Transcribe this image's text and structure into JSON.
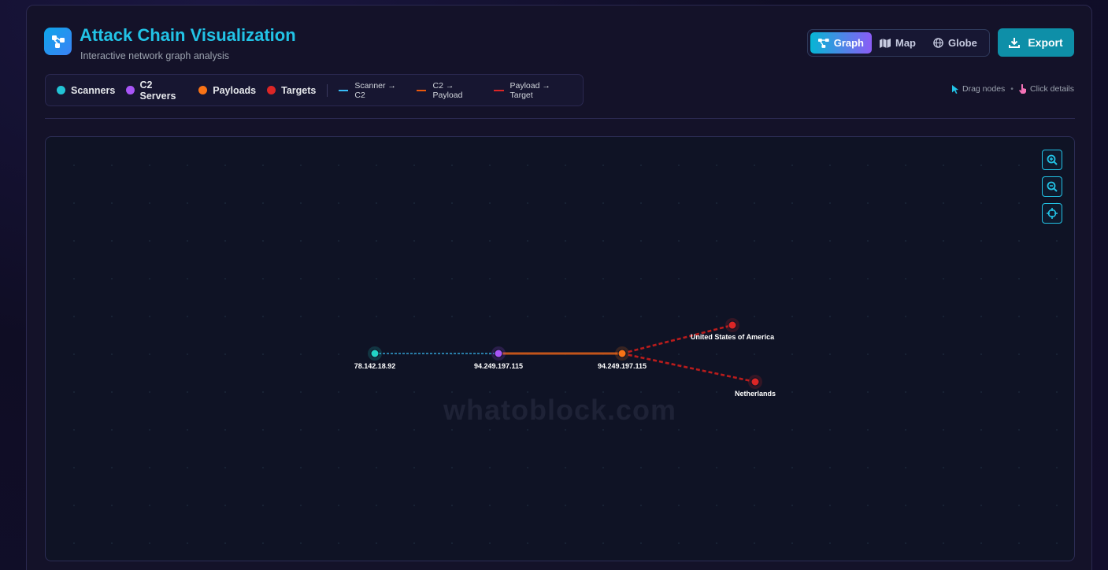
{
  "header": {
    "title": "Attack Chain Visualization",
    "subtitle": "Interactive network graph analysis"
  },
  "view_toggle": {
    "items": [
      {
        "label": "Graph",
        "active": true,
        "icon": "graph-icon"
      },
      {
        "label": "Map",
        "active": false,
        "icon": "map-icon"
      },
      {
        "label": "Globe",
        "active": false,
        "icon": "globe-icon"
      }
    ]
  },
  "export_label": "Export",
  "legend": {
    "nodes": [
      {
        "label": "Scanners",
        "color": "#22c3d6"
      },
      {
        "label": "C2 Servers",
        "color": "#a855f7"
      },
      {
        "label": "Payloads",
        "color": "#f97316"
      },
      {
        "label": "Targets",
        "color": "#dc2626"
      }
    ],
    "edges": [
      {
        "label": "Scanner → C2",
        "color": "#38bdf8",
        "style": "dashed"
      },
      {
        "label": "C2 → Payload",
        "color": "#ea580c",
        "style": "solid"
      },
      {
        "label": "Payload → Target",
        "color": "#dc2626",
        "style": "solid"
      }
    ]
  },
  "hints": {
    "drag": "Drag nodes",
    "separator": "•",
    "click": "Click details"
  },
  "watermark": "whatoblock.com",
  "graph": {
    "nodes": [
      {
        "id": "n1",
        "label": "78.142.18.92",
        "type": "scanner",
        "color": "#22d3c5"
      },
      {
        "id": "n2",
        "label": "94.249.197.115",
        "type": "c2",
        "color": "#a855f7"
      },
      {
        "id": "n3",
        "label": "94.249.197.115",
        "type": "payload",
        "color": "#f97316"
      },
      {
        "id": "n4",
        "label": "United States of America",
        "type": "target",
        "color": "#dc2626"
      },
      {
        "id": "n5",
        "label": "Netherlands",
        "type": "target",
        "color": "#dc2626"
      }
    ],
    "edges": [
      {
        "from": "n1",
        "to": "n2",
        "kind": "scanner-c2",
        "color": "#38bdf8",
        "style": "dashed"
      },
      {
        "from": "n2",
        "to": "n3",
        "kind": "c2-payload",
        "color": "#c2541a",
        "style": "solid"
      },
      {
        "from": "n3",
        "to": "n4",
        "kind": "payload-target",
        "color": "#b91c1c",
        "style": "dashed"
      },
      {
        "from": "n3",
        "to": "n5",
        "kind": "payload-target",
        "color": "#b91c1c",
        "style": "dashed"
      }
    ]
  },
  "zoom_controls": [
    {
      "name": "zoom-in",
      "icon": "zoom-in-icon"
    },
    {
      "name": "zoom-out",
      "icon": "zoom-out-icon"
    },
    {
      "name": "center",
      "icon": "crosshair-icon"
    }
  ]
}
